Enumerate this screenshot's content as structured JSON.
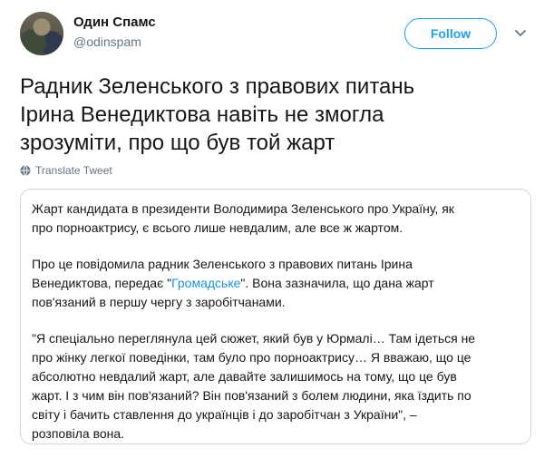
{
  "author": {
    "display_name": "Один Спамс",
    "handle": "@odinspam"
  },
  "actions": {
    "follow_label": "Follow",
    "more_icon": "chevron-down-icon"
  },
  "tweet": {
    "text_lines": [
      "Радник Зеленського з правових питань",
      "Ірина Венедиктова навіть не змогла",
      "зрозуміти, про що був той жарт"
    ],
    "translate_label": "Translate Tweet"
  },
  "quoted_article": {
    "paragraph1": [
      "Жарт кандидата в президенти Володимира Зеленського про Україну, як",
      "про порноактрису, є всього лише невдалим, але все ж жартом."
    ],
    "paragraph2": {
      "line1": "Про це повідомила радник Зеленського з правових питань Ірина",
      "line2_before": "Венедиктова, передає \"",
      "line2_link": "Громадське",
      "line2_after": "\". Вона зазначила, що дана жарт",
      "line3": "пов'язаний в першу чергу з заробітчанами."
    },
    "paragraph3": [
      "\"Я спеціально переглянула цей сюжет, який був у Юрмалі… Там ідеться не",
      "про жінку легкої поведінки, там було про порноактрису… Я вважаю, що це",
      "абсолютно невдалий жарт, але давайте залишимось на тому, що це був",
      "жарт. І з чим він пов'язаний? Він пов'язаний з болем людини, яка їздить по",
      "світу і бачить ставлення до українців і до заробітчан з України\", –",
      "розповіла вона."
    ]
  },
  "colors": {
    "accent": "#1da1f2",
    "link": "#1b95e0",
    "secondary_text": "#657786",
    "border": "#ccd6dd"
  }
}
